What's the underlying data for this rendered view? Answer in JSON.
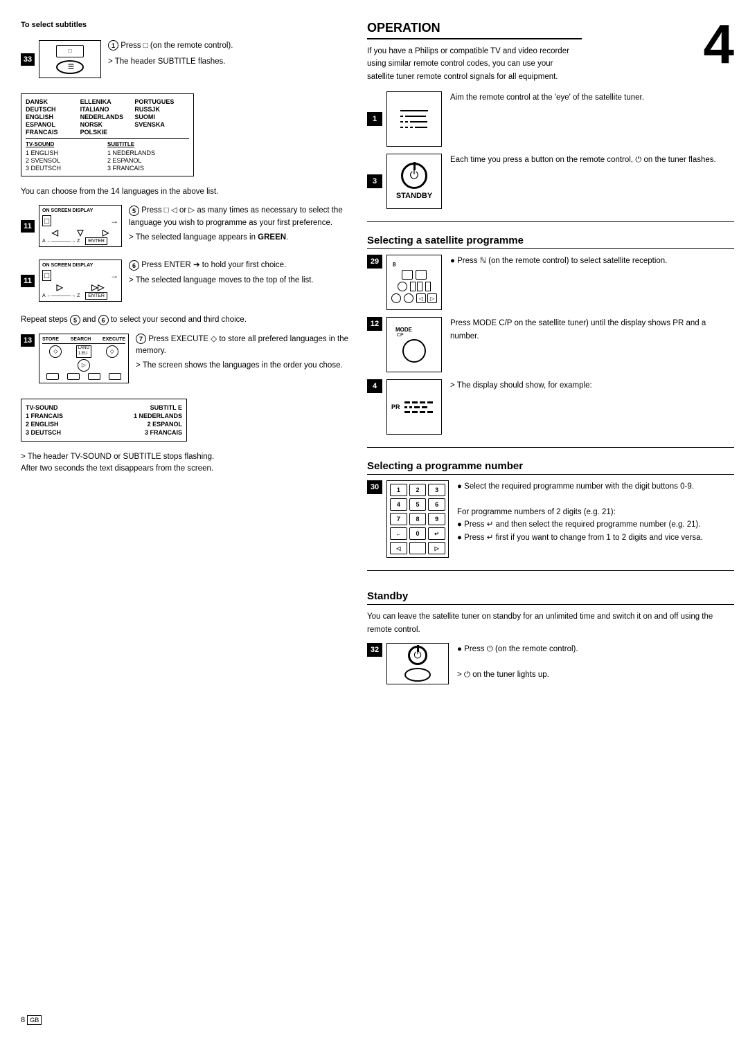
{
  "left": {
    "top_label": "To select subtitles",
    "step33_badge": "33",
    "step33_press": "① Press □ (on the remote control).",
    "step33_result": "> The header SUBTITLE flashes.",
    "lang_list_note": "You can choose from the 14 languages in the above list.",
    "step5_text": "⑤ Press □ ◁ or ▷ as many times as necessary to select the language you wish to programme as your first preference.",
    "step5_result": "> The selected language appears in GREEN.",
    "step6_text": "⑥ Press ENTER ➔ to hold your first choice.",
    "step6_result": "> The selected language moves to the top of the list.",
    "repeat_note": "Repeat steps ⑤ and ⑥ to select your second and third choice.",
    "step7_text": "⑦ Press EXECUTE ◇ to store all prefered languages in the memory.",
    "step7_result": "> The screen shows the languages in the order you chose.",
    "step_footer": "> The header TV-SOUND or SUBTITLE stops flashing. After two seconds the text disappears from the screen.",
    "lang_table": {
      "col1": [
        "DANSK",
        "DEUTSCH",
        "ENGLISH",
        "ESPANOL",
        "FRANCAIS"
      ],
      "col2": [
        "ELLENIKA",
        "ITALIANO",
        "NEDERLANDS",
        "NORSK",
        "POLSKIE"
      ],
      "col3": [
        "PORTUGUES",
        "RUSSJK",
        "SUOMI",
        "SVENSKA"
      ]
    },
    "osd_table": {
      "headers": [
        "TV-SOUND",
        "SUBTITLE"
      ],
      "rows": [
        [
          "1 ENGLISH",
          "1 NEDERLANDS"
        ],
        [
          "2 SVENSOL",
          "2 ESPANOL"
        ],
        [
          "3 DEUTSCH",
          "3 FRANCAIS"
        ]
      ]
    },
    "final_osd": {
      "headers": [
        "TV-SOUND",
        "SUBTITL E"
      ],
      "rows": [
        [
          "1 FRANCAIS",
          "1 NEDERLANDS"
        ],
        [
          "2 ENGLISH",
          "2 ESPANOL"
        ],
        [
          "3 DEUTSCH",
          "3 FRANCAIS"
        ]
      ]
    }
  },
  "right": {
    "section_title": "OPERATION",
    "section_num": "4",
    "intro": "If you have a Philips or compatible TV and video recorder using similar remote control codes, you can use your satellite tuner remote control signals for all equipment.",
    "aim_text": "Aim the remote control at the 'eye' of the satellite tuner.",
    "each_press_text": "Each time you press a button on the remote control, ⏻ on the tuner flashes.",
    "standby_label": "STANDBY",
    "sat_section": "Selecting a satellite programme",
    "sat_btn29_text": "Press ℕ (on the remote control) to select satellite reception.",
    "sat_btn12_text": "Press MODE C/P on the satellite tuner) until the display shows PR and a number.",
    "sat_display_note": "> The display should show, for example:",
    "prog_section": "Selecting a programme number",
    "select_prog_text": "Select the required programme number with the digit buttons 0-9.",
    "prog_note": "For programme numbers of 2 digits (e.g. 21):",
    "prog_bullet1": "Press ↵ and then select the required programme number (e.g. 21).",
    "prog_bullet2": "Press ↵ first if you want to change from 1 to 2 digits and vice versa.",
    "standby_section": "Standby",
    "standby_desc": "You can leave the satellite tuner on standby for an unlimited time and switch it on and off using the remote control.",
    "standby_btn_text": "Press ⏻ (on the remote control).",
    "standby_result": "> ⏻ on the tuner lights up.",
    "page_num": "8",
    "badge_1": "1",
    "badge_3": "3",
    "badge_29": "29",
    "badge_12": "12",
    "badge_4": "4",
    "badge_30": "30",
    "badge_32": "32"
  }
}
